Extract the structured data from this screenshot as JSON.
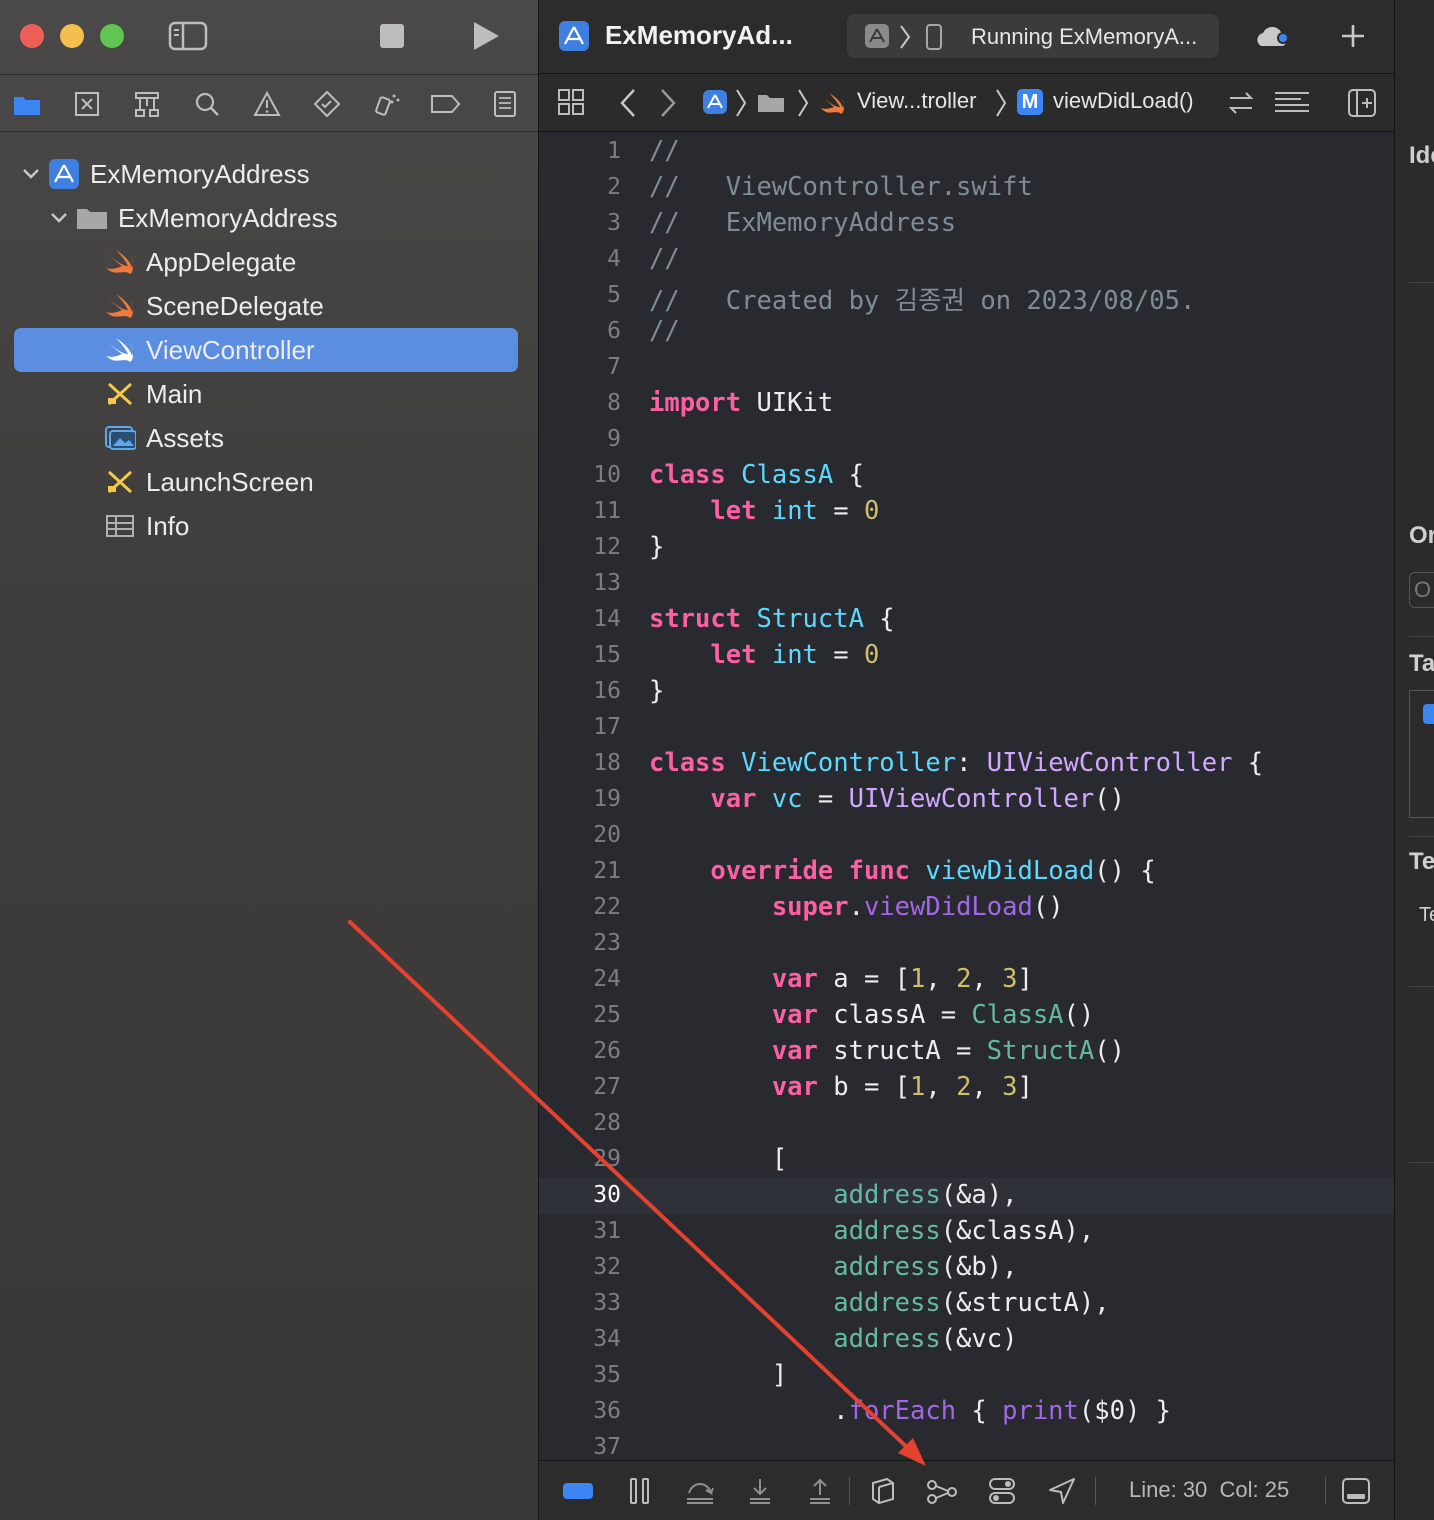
{
  "navigator": {
    "project": "ExMemoryAddress",
    "group": "ExMemoryAddress",
    "files": [
      "AppDelegate",
      "SceneDelegate",
      "ViewController",
      "Main",
      "Assets",
      "LaunchScreen",
      "Info"
    ],
    "selected": "ViewController"
  },
  "toolbar": {
    "scheme_title": "ExMemoryAd...",
    "run_status": "Running ExMemoryA..."
  },
  "jumpbar": {
    "file_crumb": "View...troller",
    "method_badge": "M",
    "method": "viewDidLoad()"
  },
  "editor": {
    "lines": [
      {
        "n": "1",
        "html": "<span class='cm'>//</span>"
      },
      {
        "n": "2",
        "html": "<span class='cm'>//   ViewController.swift</span>"
      },
      {
        "n": "3",
        "html": "<span class='cm'>//   ExMemoryAddress</span>"
      },
      {
        "n": "4",
        "html": "<span class='cm'>//</span>"
      },
      {
        "n": "5",
        "html": "<span class='cm'>//   Created by 김종권 on 2023/08/05.</span>"
      },
      {
        "n": "6",
        "html": "<span class='cm'>//</span>"
      },
      {
        "n": "7",
        "html": ""
      },
      {
        "n": "8",
        "html": "<span class='kw'>import</span> UIKit"
      },
      {
        "n": "9",
        "html": ""
      },
      {
        "n": "10",
        "html": "<span class='kw'>class</span> <span class='ty'>ClassA</span> {"
      },
      {
        "n": "11",
        "html": "    <span class='kw'>let</span> <span class='ty'>int</span> = <span class='num'>0</span>"
      },
      {
        "n": "12",
        "html": "}"
      },
      {
        "n": "13",
        "html": ""
      },
      {
        "n": "14",
        "html": "<span class='kw'>struct</span> <span class='ty'>StructA</span> {"
      },
      {
        "n": "15",
        "html": "    <span class='kw'>let</span> <span class='ty'>int</span> = <span class='num'>0</span>"
      },
      {
        "n": "16",
        "html": "}"
      },
      {
        "n": "17",
        "html": ""
      },
      {
        "n": "18",
        "html": "<span class='kw'>class</span> <span class='ty'>ViewController</span>: <span class='sys'>UIViewController</span> {"
      },
      {
        "n": "19",
        "html": "    <span class='kw'>var</span> <span class='ty'>vc</span> = <span class='sys'>UIViewController</span>()"
      },
      {
        "n": "20",
        "html": ""
      },
      {
        "n": "21",
        "html": "    <span class='kw'>override</span> <span class='kw'>func</span> <span class='ty'>viewDidLoad</span>() {"
      },
      {
        "n": "22",
        "html": "        <span class='kw'>super</span>.<span class='pfn'>viewDidLoad</span>()"
      },
      {
        "n": "23",
        "html": ""
      },
      {
        "n": "24",
        "html": "        <span class='kw'>var</span> a = [<span class='num'>1</span>, <span class='num'>2</span>, <span class='num'>3</span>]"
      },
      {
        "n": "25",
        "html": "        <span class='kw'>var</span> classA = <span class='fn'>ClassA</span>()"
      },
      {
        "n": "26",
        "html": "        <span class='kw'>var</span> structA = <span class='fn'>StructA</span>()"
      },
      {
        "n": "27",
        "html": "        <span class='kw'>var</span> b = [<span class='num'>1</span>, <span class='num'>2</span>, <span class='num'>3</span>]"
      },
      {
        "n": "28",
        "html": ""
      },
      {
        "n": "29",
        "html": "        ["
      },
      {
        "n": "30",
        "html": "            <span class='fn'>address</span>(&amp;a),"
      },
      {
        "n": "31",
        "html": "            <span class='fn'>address</span>(&amp;classA),"
      },
      {
        "n": "32",
        "html": "            <span class='fn'>address</span>(&amp;b),"
      },
      {
        "n": "33",
        "html": "            <span class='fn'>address</span>(&amp;structA),"
      },
      {
        "n": "34",
        "html": "            <span class='fn'>address</span>(&amp;vc)"
      },
      {
        "n": "35",
        "html": "        ]"
      },
      {
        "n": "36",
        "html": "            .<span class='pfn'>forEach</span> { <span class='pfn'>print</span>($0) }"
      },
      {
        "n": "37",
        "html": ""
      }
    ],
    "current_line": "30"
  },
  "statusbar": {
    "line": "Line: 30",
    "col": "Col: 25"
  },
  "inspector": {
    "headings": [
      "Ide",
      "Or",
      "O",
      "Ta",
      "Te",
      "Te"
    ]
  },
  "colors": {
    "selection": "#5b8ee0",
    "keyword": "#fc5fa3",
    "type": "#5dd8ff",
    "annotation_arrow": "#e5412f"
  }
}
